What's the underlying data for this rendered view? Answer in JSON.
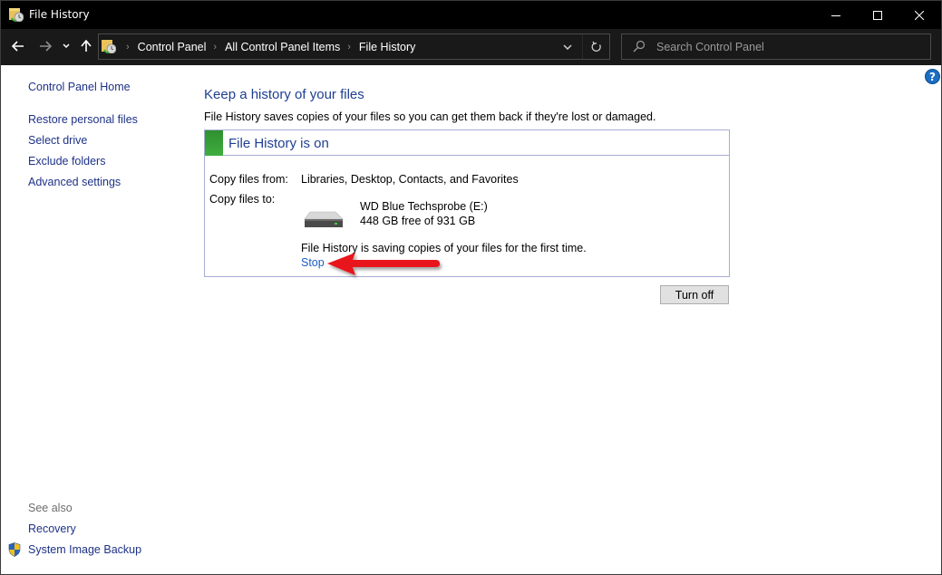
{
  "window": {
    "title": "File History",
    "controls": {
      "minimize": "minimize",
      "maximize": "maximize",
      "close": "close"
    }
  },
  "navbar": {
    "breadcrumbs": [
      "Control Panel",
      "All Control Panel Items",
      "File History"
    ],
    "search_placeholder": "Search Control Panel",
    "search_value": ""
  },
  "sidebar": {
    "home": "Control Panel Home",
    "items": [
      "Restore personal files",
      "Select drive",
      "Exclude folders",
      "Advanced settings"
    ],
    "see_also_label": "See also",
    "see_also": [
      "Recovery",
      "System Image Backup"
    ]
  },
  "main": {
    "title": "Keep a history of your files",
    "description": "File History saves copies of your files so you can get them back if they're lost or damaged.",
    "status": {
      "title": "File History is on",
      "status_color": "#3a9e3a",
      "copy_from_label": "Copy files from:",
      "copy_from_value": "Libraries, Desktop, Contacts, and Favorites",
      "copy_to_label": "Copy files to:",
      "drive_name": "WD Blue Techsprobe (E:)",
      "drive_space": "448 GB free of 931 GB",
      "progress_message": "File History is saving copies of your files for the first time.",
      "stop_link": "Stop"
    },
    "turn_off_button": "Turn off"
  },
  "annotation": {
    "arrow_color": "#e8141b",
    "points_to": "Stop"
  },
  "help": "?"
}
